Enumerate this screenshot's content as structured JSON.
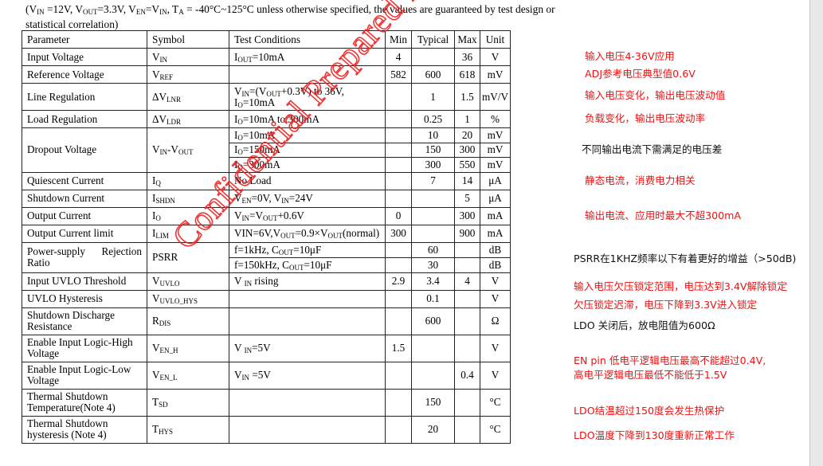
{
  "intro": {
    "conditions_html_parts": [
      "(V",
      "IN",
      " =12V, V",
      "OUT",
      "=3.3V, V",
      "EN",
      "=V",
      "IN",
      ", T",
      "A",
      " = -40°C~125°C unless otherwise specified, the values are guaranteed by test design or statistical correlation)"
    ]
  },
  "table": {
    "headers": [
      "Parameter",
      "Symbol",
      "Test Conditions",
      "Min",
      "Typical",
      "Max",
      "Unit"
    ],
    "rows": [
      {
        "param": "Input Voltage",
        "sym": [
          "V",
          "IN"
        ],
        "tc": [
          "I",
          "OUT",
          "=10mA"
        ],
        "min": "4",
        "typ": "",
        "max": "36",
        "unit": "V"
      },
      {
        "param": "Reference Voltage",
        "sym": [
          "V",
          "REF"
        ],
        "tc": [],
        "min": "582",
        "typ": "600",
        "max": "618",
        "unit": "mV"
      },
      {
        "param": "Line Regulation",
        "sym": [
          "ΔV",
          "LNR"
        ],
        "tc": [
          "V",
          "IN",
          "=(V",
          "OUT",
          "+0.3V) to 36V,"
        ],
        "tc2": [
          "I",
          "O",
          "=10mA"
        ],
        "min": "",
        "typ": "1",
        "max": "1.5",
        "unit": "mV/V"
      },
      {
        "param": "Load Regulation",
        "sym": [
          "ΔV",
          "LDR"
        ],
        "tc": [
          "I",
          "O",
          "=10mA to 300mA"
        ],
        "min": "",
        "typ": "0.25",
        "max": "1",
        "unit": "%"
      },
      {
        "param": "Dropout Voltage",
        "sym": [
          "V",
          "IN",
          "-V",
          "OUT"
        ],
        "sub_rows": [
          {
            "tc": [
              "I",
              "O",
              "=10mA"
            ],
            "min": "",
            "typ": "10",
            "max": "20",
            "unit": "mV"
          },
          {
            "tc": [
              "I",
              "O",
              "=150mA"
            ],
            "min": "",
            "typ": "150",
            "max": "300",
            "unit": "mV"
          },
          {
            "tc": [
              "I",
              "O",
              "=300mA"
            ],
            "min": "",
            "typ": "300",
            "max": "550",
            "unit": "mV"
          }
        ]
      },
      {
        "param": "Quiescent Current",
        "sym": [
          "I",
          "Q"
        ],
        "tc": [
          "No Load"
        ],
        "min": "",
        "typ": "7",
        "max": "14",
        "unit": "μA"
      },
      {
        "param": "Shutdown Current",
        "sym": [
          "I",
          "SHDN"
        ],
        "tc": [
          "V",
          "EN",
          "=0V, V",
          "IN",
          "=24V"
        ],
        "min": "",
        "typ": "",
        "max": "5",
        "unit": "μA"
      },
      {
        "param": "Output Current",
        "sym": [
          "I",
          "O"
        ],
        "tc": [
          "V",
          "IN",
          "=V",
          "OUT",
          "+0.6V"
        ],
        "min": "0",
        "typ": "",
        "max": "300",
        "unit": "mA"
      },
      {
        "param": "Output Current limit",
        "sym": [
          "I",
          "LIM"
        ],
        "tc": [
          "VIN=6V,V",
          "OUT",
          "=0.9×V",
          "OUT",
          "(normal)"
        ],
        "min": "300",
        "typ": "",
        "max": "900",
        "unit": "mA"
      },
      {
        "param": "Power-supply Rejection Ratio",
        "sym": [
          "PSRR"
        ],
        "sub_rows": [
          {
            "tc": [
              "f=1kHz, C",
              "OUT",
              "=10μF"
            ],
            "min": "",
            "typ": "60",
            "max": "",
            "unit": "dB"
          },
          {
            "tc": [
              "f=150kHz, C",
              "OUT",
              "=10μF"
            ],
            "min": "",
            "typ": "30",
            "max": "",
            "unit": "dB"
          }
        ]
      },
      {
        "param": "Input UVLO Threshold",
        "sym": [
          "V",
          "UVLO"
        ],
        "tc": [
          "V ",
          "IN",
          " rising"
        ],
        "min": "2.9",
        "typ": "3.4",
        "max": "4",
        "unit": "V"
      },
      {
        "param": "UVLO Hysteresis",
        "sym": [
          "V",
          "UVLO_HYS"
        ],
        "tc": [],
        "min": "",
        "typ": "0.1",
        "max": "",
        "unit": "V"
      },
      {
        "param": "Shutdown Discharge Resistance",
        "sym": [
          "R",
          "DIS"
        ],
        "tc": [],
        "min": "",
        "typ": "600",
        "max": "",
        "unit": "Ω"
      },
      {
        "param": "Enable Input Logic-High Voltage",
        "sym": [
          "V",
          "EN_H"
        ],
        "tc": [
          "V ",
          "IN",
          "=5V"
        ],
        "min": "1.5",
        "typ": "",
        "max": "",
        "unit": "V"
      },
      {
        "param": "Enable Input Logic-Low Voltage",
        "sym": [
          "V",
          "EN_L"
        ],
        "tc": [
          "V",
          "IN",
          " =5V"
        ],
        "min": "",
        "typ": "",
        "max": "0.4",
        "unit": "V"
      },
      {
        "param": "Thermal Shutdown Temperature(Note 4)",
        "sym": [
          "T",
          "SD"
        ],
        "tc": [],
        "min": "",
        "typ": "150",
        "max": "",
        "unit": "°C"
      },
      {
        "param": "Thermal Shutdown hysteresis (Note 4)",
        "sym": [
          "T",
          "HYS"
        ],
        "tc": [],
        "min": "",
        "typ": "20",
        "max": "",
        "unit": "°C"
      }
    ]
  },
  "notes": [
    {
      "text": "输入电压4-36V应用",
      "color": "red"
    },
    {
      "text": "ADJ参考电压典型值0.6V",
      "color": "red"
    },
    {
      "text": "输入电压变化，输出电压波动值",
      "color": "red"
    },
    {
      "text": "负载变化，输出电压波动率",
      "color": "red"
    },
    {
      "text": "不同输出电流下需满足的电压差",
      "color": "black"
    },
    {
      "text": "静态电流，消费电力相关",
      "color": "red"
    },
    {
      "text": "输出电流、应用时最大不超300mA",
      "color": "red"
    },
    {
      "text": "PSRR在1KHZ频率以下有着更好的增益（>50dB)",
      "color": "black"
    },
    {
      "text": "输入电压欠压锁定范围，电压达到3.4V解除锁定",
      "color": "red"
    },
    {
      "text": "欠压锁定迟滞，电压下降到3.3V进入锁定",
      "color": "red"
    },
    {
      "text": "LDO 关闭后，放电阻值为600Ω",
      "color": "black"
    },
    {
      "text": "EN pin 低电平逻辑电压最高不能超过0.4V,",
      "color": "red"
    },
    {
      "text": "高电平逻辑电压最低不能低于1.5V",
      "color": "red"
    },
    {
      "text": "LDO结温超过150度会发生热保护",
      "color": "red"
    },
    {
      "text": "LDO温度下降到130度重新正常工作",
      "color": "red"
    }
  ],
  "watermark": {
    "text": "Confidential Prepared for Teampo",
    "color": "#ee2222"
  }
}
